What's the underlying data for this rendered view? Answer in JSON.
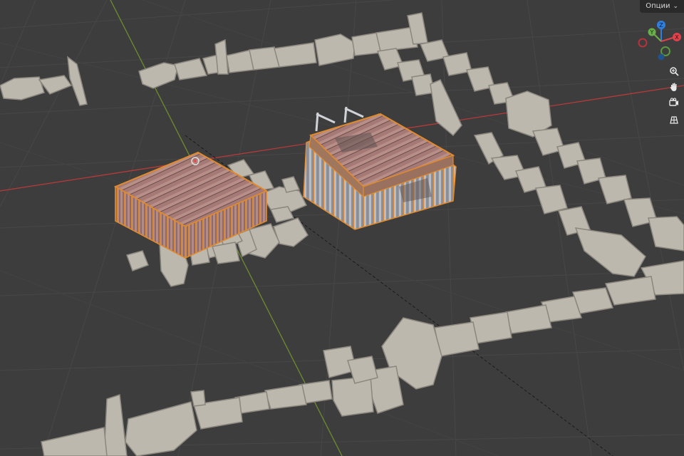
{
  "header": {
    "options_label": "Опции"
  },
  "gizmo": {
    "axes": [
      {
        "label": "Z",
        "color": "#2f7fe0"
      },
      {
        "label": "Y",
        "color": "#6ab04a"
      },
      {
        "label": "X",
        "color": "#e0424c"
      }
    ]
  },
  "nav_icons": [
    "zoom-icon",
    "hand-pan-icon",
    "camera-icon",
    "grid-icon"
  ],
  "colors": {
    "background": "#3d3d3d",
    "grid_line": "#474747",
    "x_axis": "#b83a3a",
    "y_axis": "#6e8c2e",
    "stone": "#bdb8ae",
    "stone_shadow": "#8b867e",
    "wood": "#a9797a",
    "selection_outline": "#e08a2e"
  }
}
